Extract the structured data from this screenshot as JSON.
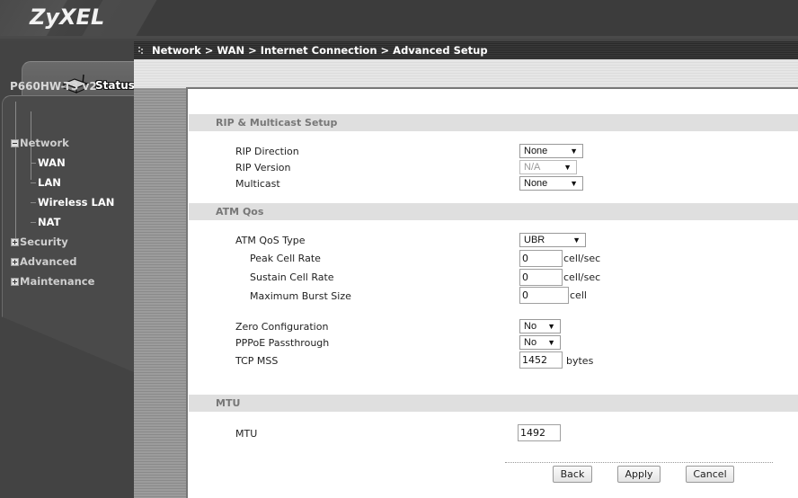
{
  "header": {
    "logo": "ZyXEL"
  },
  "sidebar": {
    "status_label": "Status",
    "device_name": "P660HW-T3 v2",
    "tree": {
      "network": {
        "label": "Network",
        "expanded": true,
        "children": [
          {
            "label": "WAN"
          },
          {
            "label": "LAN"
          },
          {
            "label": "Wireless LAN"
          },
          {
            "label": "NAT"
          }
        ]
      },
      "security": {
        "label": "Security",
        "expanded": false
      },
      "advanced": {
        "label": "Advanced",
        "expanded": false
      },
      "maintenance": {
        "label": "Maintenance",
        "expanded": false
      }
    }
  },
  "breadcrumb": {
    "text": "Network > WAN > Internet Connection > Advanced Setup"
  },
  "sections": {
    "rip": {
      "title": "RIP & Multicast Setup",
      "rip_direction": {
        "label": "RIP Direction",
        "value": "None"
      },
      "rip_version": {
        "label": "RIP Version",
        "value": "N/A",
        "disabled": true
      },
      "multicast": {
        "label": "Multicast",
        "value": "None"
      }
    },
    "atm": {
      "title": "ATM Qos",
      "qos_type": {
        "label": "ATM QoS Type",
        "value": "UBR"
      },
      "peak_cell_rate": {
        "label": "Peak Cell Rate",
        "value": "0",
        "unit": "cell/sec"
      },
      "sustain_cell_rate": {
        "label": "Sustain Cell Rate",
        "value": "0",
        "unit": "cell/sec"
      },
      "max_burst_size": {
        "label": "Maximum Burst Size",
        "value": "0",
        "unit": "cell"
      },
      "zero_config": {
        "label": "Zero Configuration",
        "value": "No"
      },
      "pppoe_passthrough": {
        "label": "PPPoE Passthrough",
        "value": "No"
      },
      "tcp_mss": {
        "label": "TCP MSS",
        "value": "1452",
        "unit": "bytes"
      }
    },
    "mtu": {
      "title": "MTU",
      "mtu": {
        "label": "MTU",
        "value": "1492"
      }
    }
  },
  "buttons": {
    "back": "Back",
    "apply": "Apply",
    "cancel": "Cancel"
  }
}
